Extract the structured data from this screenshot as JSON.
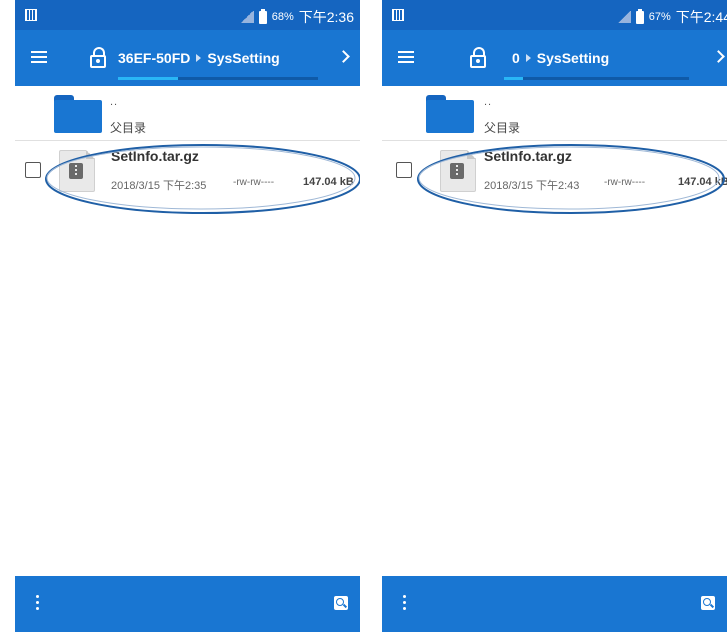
{
  "screens": [
    {
      "status": {
        "battery_pct": "68%",
        "time": "下午2:36"
      },
      "toolbar": {
        "crumb_root": "36EF-50FD",
        "crumb_current": "SysSetting",
        "progress_fraction": 0.3
      },
      "parent_dir": {
        "dots": "..",
        "label": "父目录"
      },
      "file": {
        "name": "SetInfo.tar.gz",
        "date": "2018/3/15 下午2:35",
        "permissions": "-rw-rw----",
        "size": "147.04 kB"
      }
    },
    {
      "status": {
        "battery_pct": "67%",
        "time": "下午2:44"
      },
      "toolbar": {
        "crumb_root": "0",
        "crumb_current": "SysSetting",
        "progress_fraction": 0.1
      },
      "parent_dir": {
        "dots": "..",
        "label": "父目录"
      },
      "file": {
        "name": "SetInfo.tar.gz",
        "date": "2018/3/15 下午2:43",
        "permissions": "-rw-rw----",
        "size": "147.04 kB"
      }
    }
  ],
  "colors": {
    "toolbar": "#1976d2",
    "statusbar": "#1565c0",
    "highlight_oval": "#1f5fa6"
  },
  "icons": [
    "app-icon",
    "signal-icon",
    "battery-icon",
    "menu-icon",
    "lock-icon",
    "chevron-right-icon",
    "folder-icon",
    "archive-file-icon",
    "more-vert-icon",
    "search-icon"
  ]
}
